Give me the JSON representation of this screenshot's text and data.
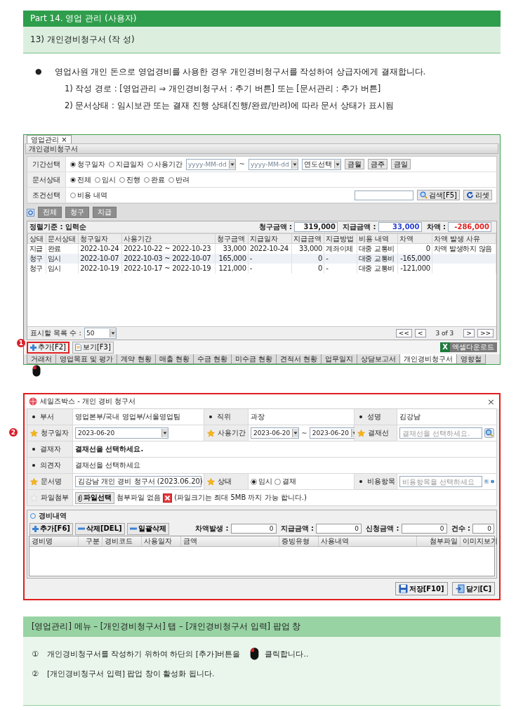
{
  "header": {
    "part": "Part 14. 영업 관리 (사용자)",
    "section": "13) 개인경비청구서 (작 성)"
  },
  "intro": {
    "bullet": "●",
    "text": "영업사원 개인 돈으로 영업경비를 사용한 경우 개인경비청구서를 작성하여 상급자에게 결재합니다.",
    "steps": [
      "1) 작성 경로 : [영업관리 ⇒ 개인경비청구서 : 추기 버튼] 또는 [문서관리 : 추가 버튼]",
      "2) 문서상태 : 임시보관 또는 결재 진행 상태(진행/완료/반려)에 따라 문서 상태가 표시됨"
    ]
  },
  "list_screen": {
    "doc_tab": {
      "label": "영업관리",
      "close": "×"
    },
    "panel_title": "개인경비청구서",
    "filters": [
      {
        "label": "기간선택",
        "radios": [
          {
            "label": "청구일자",
            "selected": true
          },
          {
            "label": "지급일자",
            "selected": false
          },
          {
            "label": "사용기간",
            "selected": false
          }
        ],
        "date_from": "yyyy-MM-dd",
        "range_sep": "~",
        "date_to": "yyyy-MM-dd",
        "year_select": "연도선택",
        "buttons": [
          "금월",
          "금주",
          "금일"
        ]
      },
      {
        "label": "문서상태",
        "radios": [
          {
            "label": "전체",
            "selected": true
          },
          {
            "label": "임시",
            "selected": false
          },
          {
            "label": "진행",
            "selected": false
          },
          {
            "label": "완료",
            "selected": false
          },
          {
            "label": "반려",
            "selected": false
          }
        ]
      },
      {
        "label": "조건선택",
        "radios": [
          {
            "label": "비용 내역",
            "selected": false
          }
        ],
        "search_buttons": [
          "검색[F5]",
          "리셋"
        ]
      }
    ],
    "type_buttons": [
      "전체",
      "청구",
      "지급"
    ],
    "sort_caption": "정렬기준 : 입력순",
    "totals": [
      {
        "label": "청구금액 :",
        "value": "319,000",
        "color": "#222222"
      },
      {
        "label": "지급금액 :",
        "value": "33,000",
        "color": "#2a3fd0"
      },
      {
        "label": "차액 :",
        "value": "-286,000",
        "color": "#e02020"
      }
    ],
    "columns": [
      "상태",
      "문서상태",
      "청구일자",
      "사용기간",
      "청구금액",
      "지급일자",
      "지급금액",
      "지급방법",
      "비용 내역",
      "차액",
      "차액 발생 사유"
    ],
    "rows": [
      [
        "지급",
        "완료",
        "2022-10-24",
        "2022-10-22 ~ 2022-10-23",
        "33,000",
        "2022-10-24",
        "33,000",
        "계좌이체",
        "대중 교통비",
        "0",
        "차액 발생하지 않음"
      ],
      [
        "청구",
        "임시",
        "2022-10-07",
        "2022-10-03 ~ 2022-10-07",
        "165,000",
        "-",
        "0",
        "-",
        "대중 교통비",
        "-165,000"
      ],
      [
        "청구",
        "임시",
        "2022-10-19",
        "2022-10-17 ~ 2022-10-19",
        "121,000",
        "-",
        "0",
        "-",
        "대중 교통비",
        "-121,000"
      ]
    ],
    "page_size": {
      "label": "표시할 목록 수 :",
      "value": "50"
    },
    "pager": {
      "first": "<<",
      "prev": "<",
      "status": "3 of 3",
      "next": ">",
      "last": ">>"
    },
    "actions": [
      {
        "label": "추가[F2]",
        "highlighted": true,
        "callout": "1"
      },
      {
        "label": "보기[F3]",
        "highlighted": false
      }
    ],
    "excel": {
      "letter": "X",
      "label": "엑셀다운로드"
    },
    "bottom_tabs": [
      {
        "label": "거래처",
        "selected": false
      },
      {
        "label": "영업목표 및 평가",
        "selected": false
      },
      {
        "label": "계약 현황",
        "selected": false
      },
      {
        "label": "매출 현황",
        "selected": false
      },
      {
        "label": "수금 현황",
        "selected": false
      },
      {
        "label": "미수금 현황",
        "selected": false
      },
      {
        "label": "견적서 현황",
        "selected": false
      },
      {
        "label": "업무일지",
        "selected": false
      },
      {
        "label": "상담보고서",
        "selected": false
      },
      {
        "label": "개인경비청구서",
        "selected": true
      },
      {
        "label": "영향철",
        "selected": false
      }
    ]
  },
  "popup": {
    "callout": "2",
    "title": "세일즈박스 - 개인 경비 청구서",
    "close": "×",
    "rows": [
      [
        {
          "kind": "dot",
          "text": "부서"
        },
        {
          "kind": "text",
          "text": "영업본부/국내 영업부/서울영업팀",
          "bold": false
        },
        {
          "kind": "dot",
          "text": "직위"
        },
        {
          "kind": "text",
          "text": "과장",
          "bold": false
        },
        {
          "kind": "dot",
          "text": "성명"
        },
        {
          "kind": "text",
          "text": "김강남",
          "bold": false
        }
      ],
      [
        {
          "kind": "star",
          "text": "청구일자"
        },
        {
          "kind": "date",
          "value": "2023-06-20"
        },
        {
          "kind": "star",
          "text": "사용기간"
        },
        {
          "kind": "daterange",
          "from": "2023-06-20",
          "sep": "~",
          "to": "2023-06-20"
        },
        {
          "kind": "star",
          "text": "결재선"
        },
        {
          "kind": "lookup",
          "placeholder": "결재선을 선택하세요.",
          "info": false
        }
      ],
      [
        {
          "kind": "dot",
          "text": "결재자"
        },
        {
          "kind": "text",
          "text": "결재선을 선택하세요.",
          "bold": true
        }
      ],
      [
        {
          "kind": "dot",
          "text": "의견자"
        },
        {
          "kind": "text",
          "text": "결재선을 선택하세요",
          "bold": false
        }
      ],
      [
        {
          "kind": "star",
          "text": "문서명"
        },
        {
          "kind": "input",
          "value": "김강남 개인 경비 청구서 (2023.06.20)"
        },
        {
          "kind": "star",
          "text": "상태"
        },
        {
          "kind": "radios",
          "options": [
            {
              "label": "임시",
              "selected": true
            },
            {
              "label": "결재",
              "selected": false
            }
          ]
        },
        {
          "kind": "dot",
          "text": "비용항목"
        },
        {
          "kind": "lookup",
          "placeholder": "비용항목을 선택하세요",
          "info": true
        }
      ],
      [
        {
          "kind": "faintstar",
          "text": "파일첨부"
        },
        {
          "kind": "file",
          "button": "파일선택",
          "status": "첨부파일 없음",
          "note": "(파일크기는 최대 5MB 까지 가능 합니다.)"
        }
      ]
    ],
    "expense": {
      "title": "경비내역",
      "buttons": [
        "추가[F6]",
        "삭제[DEL]",
        "일괄삭제"
      ],
      "totals": [
        {
          "label": "차액발생 :",
          "value": "0"
        },
        {
          "label": "지급금액 :",
          "value": "0"
        },
        {
          "label": "신청금액 :",
          "value": "0"
        },
        {
          "label": "건수 :",
          "value": "0"
        }
      ],
      "columns": [
        "경비명",
        "구분",
        "경비코드",
        "사용일자",
        "금액",
        "증빙유형",
        "사용내역",
        "첨부파일",
        "이미지보기"
      ]
    },
    "footer_buttons": [
      "저장[F10]",
      "닫기[C]"
    ]
  },
  "notes": {
    "title": "[영업관리] 메뉴 – [개인경비청구서] 탭 – [개인경비청구서 입력] 팝업 창",
    "items": [
      {
        "num": "①",
        "text": "개인경비청구서를 작성하기 위하여 하단의 [추가]버튼을",
        "mouse": true,
        "after": "클릭합니다.."
      },
      {
        "num": "②",
        "text": "[개인경비청구서 입력]  팝업 창이 활성화 됩니다.",
        "mouse": false
      }
    ]
  }
}
